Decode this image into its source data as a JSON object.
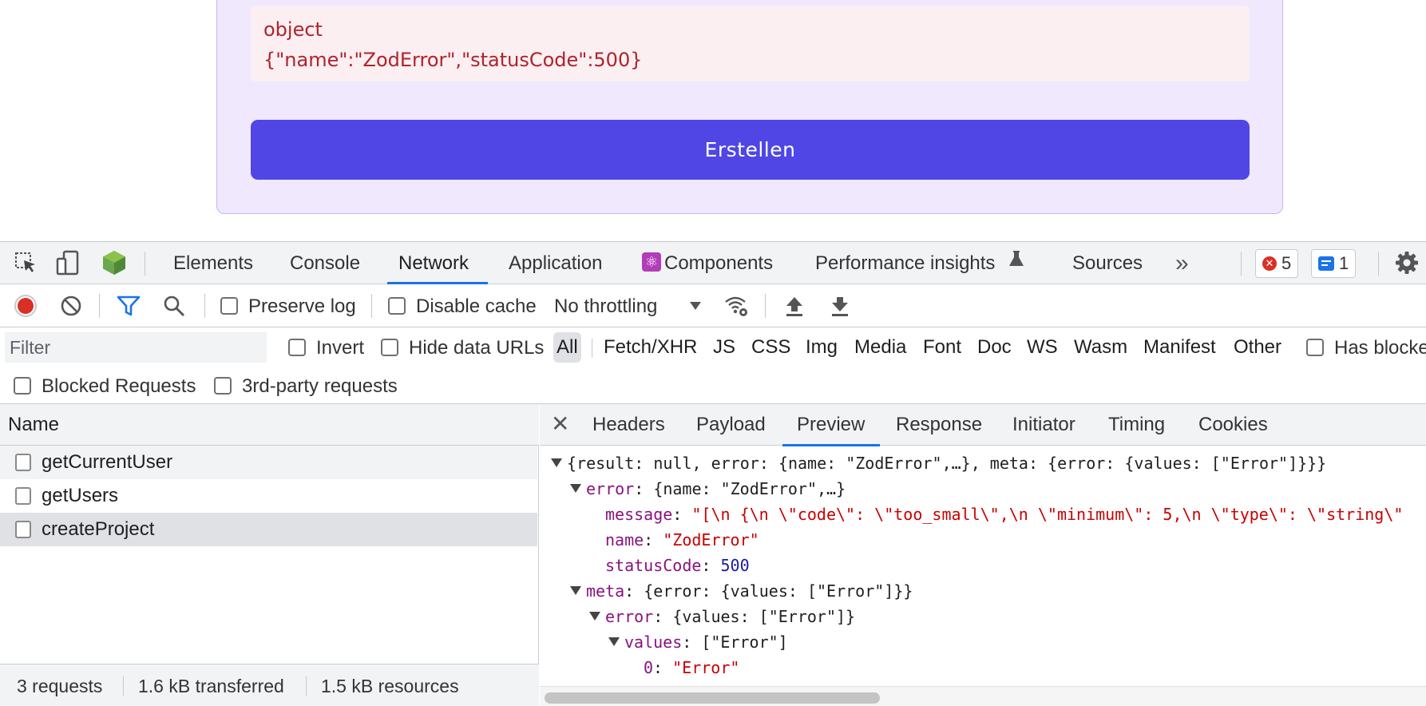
{
  "page": {
    "error_type": "object",
    "error_json": "{\"name\":\"ZodError\",\"statusCode\":500}",
    "submit_label": "Erstellen"
  },
  "devtools": {
    "tabs": [
      "Elements",
      "Console",
      "Network",
      "Application",
      "Components",
      "Performance insights",
      "Sources"
    ],
    "active_tab": "Network",
    "more_tabs": "»",
    "errors_count": "5",
    "messages_count": "1",
    "toolbar": {
      "preserve_log": "Preserve log",
      "disable_cache": "Disable cache",
      "throttling": "No throttling"
    },
    "filter": {
      "placeholder": "Filter",
      "invert": "Invert",
      "hide_data_urls": "Hide data URLs",
      "types": [
        "All",
        "Fetch/XHR",
        "JS",
        "CSS",
        "Img",
        "Media",
        "Font",
        "Doc",
        "WS",
        "Wasm",
        "Manifest",
        "Other"
      ],
      "selected_type": "All",
      "has_blocked": "Has blocked cookies",
      "blocked_requests": "Blocked Requests",
      "third_party": "3rd-party requests"
    },
    "requests": {
      "column": "Name",
      "rows": [
        "getCurrentUser",
        "getUsers",
        "createProject"
      ],
      "footer": {
        "count": "3 requests",
        "transferred": "1.6 kB transferred",
        "resources": "1.5 kB resources"
      }
    },
    "detail_tabs": [
      "Headers",
      "Payload",
      "Preview",
      "Response",
      "Initiator",
      "Timing",
      "Cookies"
    ],
    "active_detail_tab": "Preview",
    "preview": {
      "root": "{result: null, error: {name: \"ZodError\",…}, meta: {error: {values: [\"Error\"]}}}",
      "error_key": "error",
      "error_summary": "{name: \"ZodError\",…}",
      "message_key": "message",
      "message_value": "\"[\\n  {\\n    \\\"code\\\": \\\"too_small\\\",\\n    \\\"minimum\\\": 5,\\n    \\\"type\\\": \\\"string\\\"",
      "name_key": "name",
      "name_value": "\"ZodError\"",
      "status_key": "statusCode",
      "status_value": "500",
      "meta_key": "meta",
      "meta_summary": "{error: {values: [\"Error\"]}}",
      "meta_error_key": "error",
      "meta_error_summary": "{values: [\"Error\"]}",
      "values_key": "values",
      "values_summary": "[\"Error\"]",
      "item_index": "0",
      "item_value": "\"Error\""
    }
  },
  "colors": {
    "accent": "#4f46e5",
    "error_text": "#b0232a",
    "devtools_blue": "#1a73e8",
    "record_red": "#d93025"
  }
}
